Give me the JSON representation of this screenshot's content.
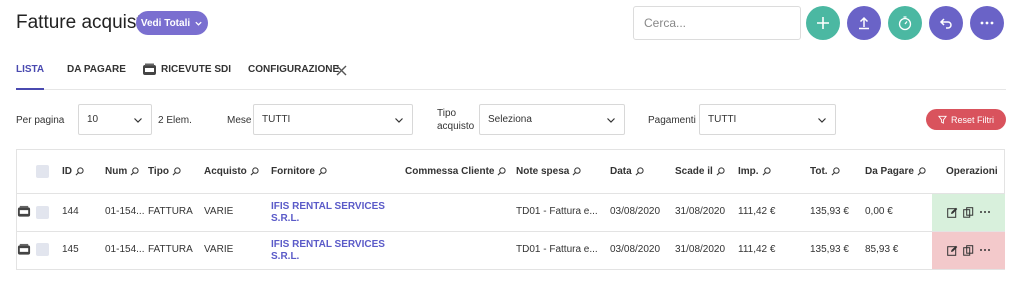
{
  "header": {
    "title": "Fatture acquisti",
    "vedi_totali_label": "Vedi Totali",
    "search_placeholder": "Cerca..."
  },
  "action_buttons": [
    {
      "icon": "plus-icon",
      "color": "#4bb8a2"
    },
    {
      "icon": "upload-icon",
      "color": "#6a63c7"
    },
    {
      "icon": "timer-icon",
      "color": "#4bb8a2"
    },
    {
      "icon": "undo-icon",
      "color": "#6a63c7"
    },
    {
      "icon": "more-icon",
      "color": "#6a63c7"
    }
  ],
  "tabs": [
    {
      "label": "LISTA",
      "active": true
    },
    {
      "label": "DA PAGARE",
      "active": false
    },
    {
      "label": "RICEVUTE SDI",
      "active": false
    },
    {
      "label": "CONFIGURAZIONE",
      "active": false
    }
  ],
  "filters": {
    "per_pagina_label": "Per pagina",
    "per_pagina_value": "10",
    "elem_count": "2 Elem.",
    "mese_label": "Mese",
    "mese_value": "TUTTI",
    "tipo_label_1": "Tipo",
    "tipo_label_2": "acquisto",
    "tipo_value": "Seleziona",
    "pagamenti_label": "Pagamenti",
    "pagamenti_value": "TUTTI",
    "reset_label": "Reset Filtri"
  },
  "table": {
    "columns": [
      "ID",
      "Num",
      "Tipo",
      "Acquisto",
      "Fornitore",
      "Commessa Cliente",
      "Note spesa",
      "Data",
      "Scade il",
      "Imp.",
      "Tot.",
      "Da Pagare",
      "Operazioni"
    ],
    "rows": [
      {
        "id": "144",
        "num": "01-154...",
        "tipo": "FATTURA",
        "acquisto": "VARIE",
        "fornitore_1": "IFIS RENTAL SERVICES",
        "fornitore_2": "S.R.L.",
        "commessa": "",
        "note": "TD01 - Fattura e...",
        "data": "03/08/2020",
        "scade": "31/08/2020",
        "imp": "111,42 €",
        "tot": "135,93 €",
        "da_pagare": "0,00 €",
        "status_color": "#d8f0dc"
      },
      {
        "id": "145",
        "num": "01-154...",
        "tipo": "FATTURA",
        "acquisto": "VARIE",
        "fornitore_1": "IFIS RENTAL SERVICES",
        "fornitore_2": "S.R.L.",
        "commessa": "",
        "note": "TD01 - Fattura e...",
        "data": "03/08/2020",
        "scade": "31/08/2020",
        "imp": "111,42 €",
        "tot": "135,93 €",
        "da_pagare": "85,93 €",
        "status_color": "#f3c9cb"
      }
    ]
  },
  "colors": {
    "accent": "#4a4ab0",
    "link": "#5a5ac8",
    "vedi_totali": "#7a6fd0",
    "reset": "#d9535d"
  }
}
